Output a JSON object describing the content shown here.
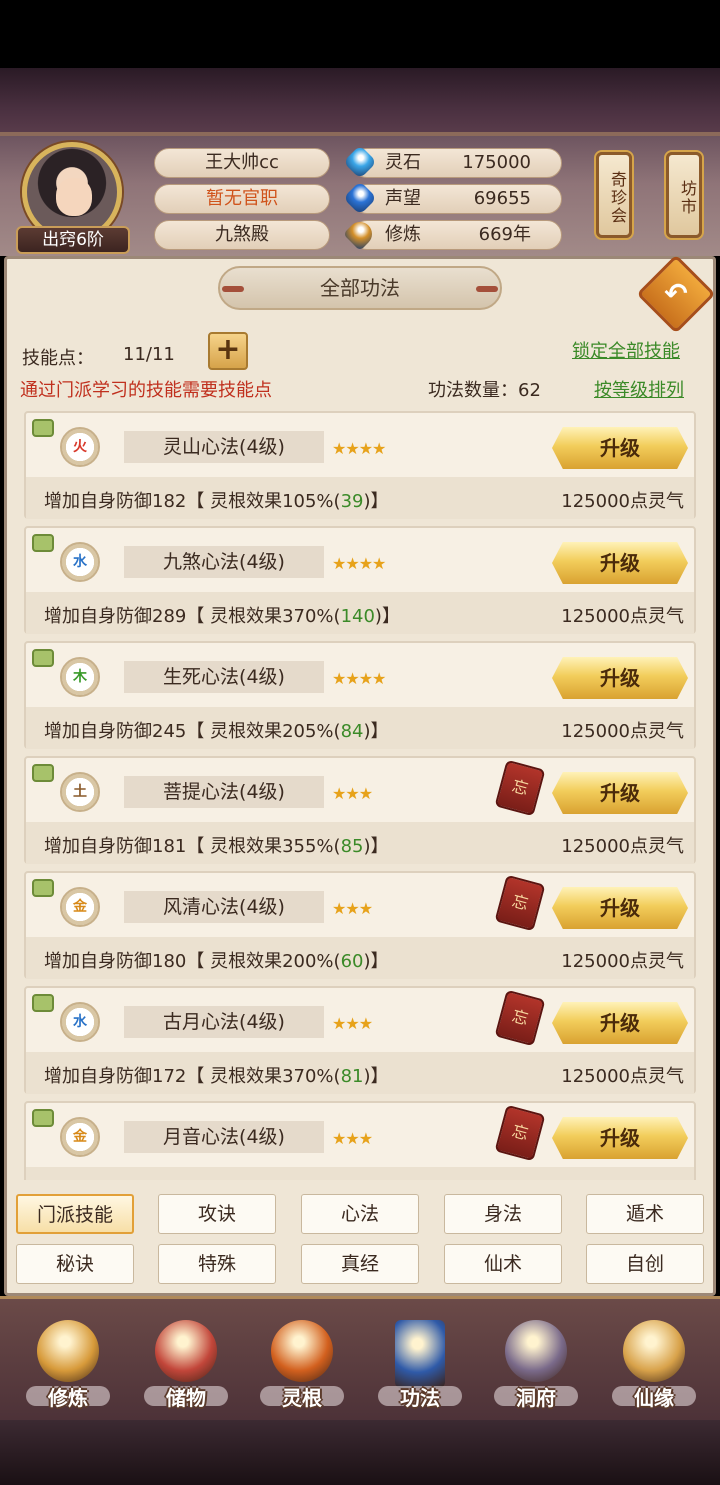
{
  "player": {
    "name": "王大帅cc",
    "title": "暂无官职",
    "sect": "九煞殿",
    "rank_badge": "出窍6阶"
  },
  "resources": [
    {
      "label": "灵石",
      "value": "175000",
      "icon": "spirit-stone-icon",
      "color": "#3aa6e8"
    },
    {
      "label": "声望",
      "value": "69655",
      "icon": "prestige-icon",
      "color": "#2b73d6"
    },
    {
      "label": "修炼",
      "value": "669年",
      "icon": "meditation-icon",
      "color": "#d4902a"
    }
  ],
  "side_buttons": {
    "treasure": "奇珍会",
    "market": "坊市"
  },
  "panel": {
    "title": "全部功法",
    "skill_points_label": "技能点：",
    "skill_points_value": "11/11",
    "lock_all": "锁定全部技能",
    "hint": "通过门派学习的技能需要技能点",
    "count_label": "功法数量：62",
    "sort_label": "按等级排列"
  },
  "skills": [
    {
      "element": "火",
      "element_color": "#d8382a",
      "name": "灵山心法(4级)",
      "stars": "★★★★",
      "forgettable": false,
      "desc_prefix": "增加自身防御182【 灵根效果105%(",
      "desc_green": "39",
      "desc_suffix": ")】",
      "cost": "125000点灵气",
      "button": "升级"
    },
    {
      "element": "水",
      "element_color": "#2a73c8",
      "name": "九煞心法(4级)",
      "stars": "★★★★",
      "forgettable": false,
      "desc_prefix": "增加自身防御289【 灵根效果370%(",
      "desc_green": "140",
      "desc_suffix": ")】",
      "cost": "125000点灵气",
      "button": "升级"
    },
    {
      "element": "木",
      "element_color": "#3a9a2a",
      "name": "生死心法(4级)",
      "stars": "★★★★",
      "forgettable": false,
      "desc_prefix": "增加自身防御245【 灵根效果205%(",
      "desc_green": "84",
      "desc_suffix": ")】",
      "cost": "125000点灵气",
      "button": "升级"
    },
    {
      "element": "土",
      "element_color": "#8a5a2a",
      "name": "菩提心法(4级)",
      "stars": "★★★",
      "forgettable": true,
      "desc_prefix": "增加自身防御181【 灵根效果355%(",
      "desc_green": "85",
      "desc_suffix": ")】",
      "cost": "125000点灵气",
      "button": "升级"
    },
    {
      "element": "金",
      "element_color": "#d88a1a",
      "name": "风清心法(4级)",
      "stars": "★★★",
      "forgettable": true,
      "desc_prefix": "增加自身防御180【 灵根效果200%(",
      "desc_green": "60",
      "desc_suffix": ")】",
      "cost": "125000点灵气",
      "button": "升级"
    },
    {
      "element": "水",
      "element_color": "#2a73c8",
      "name": "古月心法(4级)",
      "stars": "★★★",
      "forgettable": true,
      "desc_prefix": "增加自身防御172【 灵根效果370%(",
      "desc_green": "81",
      "desc_suffix": ")】",
      "cost": "125000点灵气",
      "button": "升级"
    },
    {
      "element": "金",
      "element_color": "#d88a1a",
      "name": "月音心法(4级)",
      "stars": "★★★",
      "forgettable": true,
      "desc_prefix": "",
      "desc_green": "",
      "desc_suffix": "",
      "cost": "",
      "button": "升级"
    }
  ],
  "forget_label": "忘",
  "category_tabs": [
    {
      "label": "门派技能",
      "active": true
    },
    {
      "label": "攻诀",
      "active": false
    },
    {
      "label": "心法",
      "active": false
    },
    {
      "label": "身法",
      "active": false
    },
    {
      "label": "遁术",
      "active": false
    },
    {
      "label": "秘诀",
      "active": false
    },
    {
      "label": "特殊",
      "active": false
    },
    {
      "label": "真经",
      "active": false
    },
    {
      "label": "仙术",
      "active": false
    },
    {
      "label": "自创",
      "active": false
    }
  ],
  "nav": [
    {
      "label": "修炼",
      "icon": "cultivate-icon",
      "color": "#d79a3a"
    },
    {
      "label": "储物",
      "icon": "storage-bag-icon",
      "color": "#c2463a"
    },
    {
      "label": "灵根",
      "icon": "spirit-root-icon",
      "color": "#d2601e"
    },
    {
      "label": "功法",
      "icon": "skill-book-icon",
      "color": "#2f5aa8"
    },
    {
      "label": "洞府",
      "icon": "cave-dwelling-icon",
      "color": "#7a6a8a"
    },
    {
      "label": "仙缘",
      "icon": "gourd-icon",
      "color": "#d8a24a"
    }
  ]
}
